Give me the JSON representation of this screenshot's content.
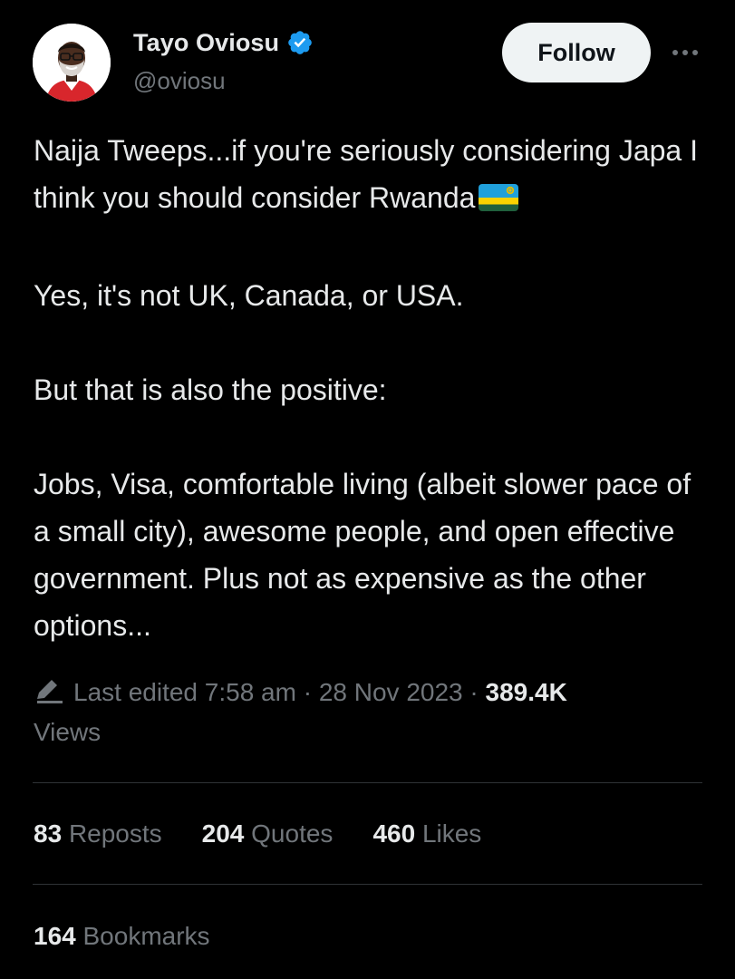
{
  "author": {
    "display_name": "Tayo Oviosu",
    "handle": "@oviosu",
    "verified": true
  },
  "actions": {
    "follow_label": "Follow",
    "more_icon": "more-horizontal-icon"
  },
  "tweet": {
    "paragraphs": [
      "Naija Tweeps...if you're seriously considering Japa I think you should consider Rwanda",
      "Yes, it's not UK, Canada, or USA.",
      "But that is also the positive:",
      "Jobs, Visa, comfortable living (albeit slower pace of a small city), awesome people, and open effective government. Plus not as expensive as the other options..."
    ],
    "emoji": "rwanda-flag"
  },
  "meta": {
    "edited_label": "Last edited 7:58 am · 28 Nov 2023 ·",
    "views_count": "389.4K",
    "views_label": "Views"
  },
  "stats": {
    "reposts_count": "83",
    "reposts_label": "Reposts",
    "quotes_count": "204",
    "quotes_label": "Quotes",
    "likes_count": "460",
    "likes_label": "Likes",
    "bookmarks_count": "164",
    "bookmarks_label": "Bookmarks"
  },
  "colors": {
    "background": "#000000",
    "primary_text": "#e7e9ea",
    "secondary_text": "#71767b",
    "verified_blue": "#1d9bf0",
    "follow_button_bg": "#eff3f4",
    "divider": "#2f3336"
  }
}
